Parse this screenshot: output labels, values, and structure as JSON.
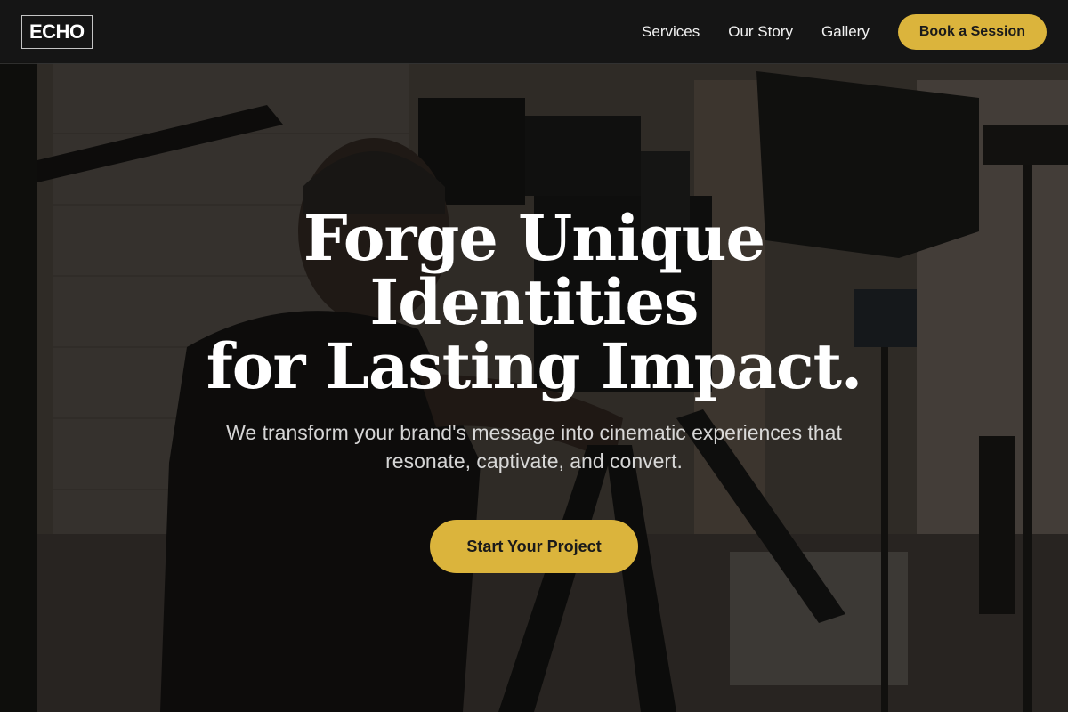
{
  "brand": {
    "logo_text": "ECHO"
  },
  "nav": {
    "links": [
      {
        "label": "Services"
      },
      {
        "label": "Our Story"
      },
      {
        "label": "Gallery"
      }
    ],
    "cta_label": "Book a Session"
  },
  "hero": {
    "headline_line1": "Forge Unique Identities",
    "headline_line2": "for Lasting Impact.",
    "subheadline": "We transform your brand's message into cinematic experiences that resonate, captivate, and convert.",
    "cta_label": "Start Your Project",
    "background_image": "videographer-with-camera-on-tripod-in-studio"
  },
  "colors": {
    "accent": "#dbb43c",
    "nav_background": "#141414",
    "text_primary": "#ffffff",
    "button_text": "#1a1a1a"
  }
}
